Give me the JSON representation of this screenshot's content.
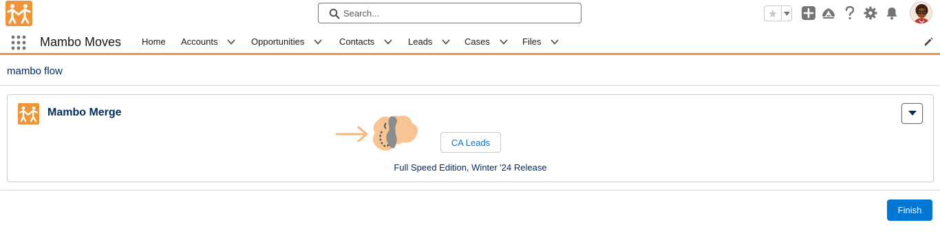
{
  "header": {
    "search": {
      "placeholder": "Search..."
    },
    "icons": [
      "star-icon",
      "chevron-down-icon",
      "add-icon",
      "trailhead-icon",
      "help-icon",
      "settings-icon",
      "notifications-icon",
      "avatar"
    ]
  },
  "nav": {
    "app_name": "Mambo Moves",
    "items": [
      {
        "label": "Home",
        "dropdown": false
      },
      {
        "label": "Accounts",
        "dropdown": true
      },
      {
        "label": "Opportunities",
        "dropdown": true
      },
      {
        "label": "Contacts",
        "dropdown": true
      },
      {
        "label": "Leads",
        "dropdown": true
      },
      {
        "label": "Cases",
        "dropdown": true
      },
      {
        "label": "Files",
        "dropdown": true
      }
    ]
  },
  "page": {
    "title": "mambo flow"
  },
  "card": {
    "title": "Mambo Merge",
    "leads_button": "CA Leads",
    "release": "Full Speed Edition, Winter '24 Release"
  },
  "footer": {
    "finish_button": "Finish"
  },
  "colors": {
    "brand_orange": "#f0943a",
    "brand_blue": "#0176d3",
    "title_navy": "#032d60"
  }
}
